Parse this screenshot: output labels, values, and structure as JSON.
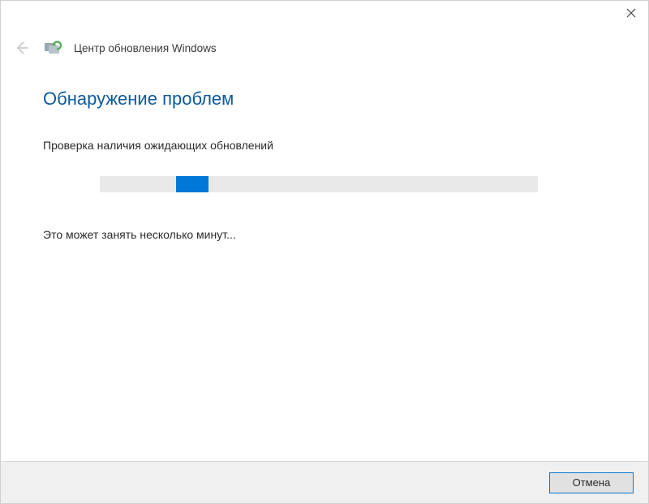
{
  "window": {
    "app_title": "Центр обновления Windows"
  },
  "main": {
    "heading": "Обнаружение проблем",
    "status": "Проверка наличия ожидающих обновлений",
    "hint": "Это может занять несколько минут...",
    "progress": {
      "indeterminate": true,
      "chunk_position_percent": 17
    }
  },
  "footer": {
    "cancel_label": "Отмена"
  },
  "icons": {
    "close": "close-icon",
    "back": "back-arrow-icon",
    "update": "windows-update-icon"
  }
}
